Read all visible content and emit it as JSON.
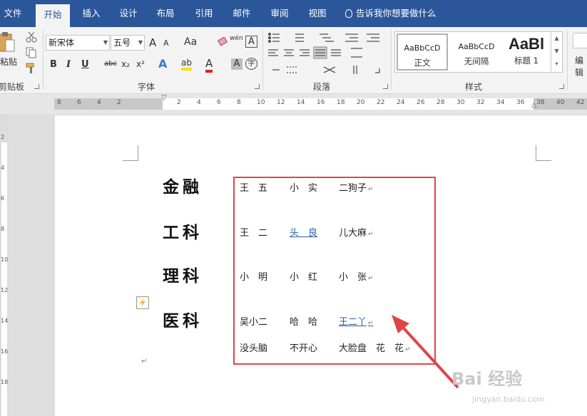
{
  "menu": {
    "tabs": [
      "文件",
      "开始",
      "插入",
      "设计",
      "布局",
      "引用",
      "邮件",
      "审阅",
      "视图"
    ],
    "tell_me": "告诉我你想要做什么"
  },
  "ribbon": {
    "clipboard": {
      "paste": "粘贴",
      "group": "剪贴板"
    },
    "font": {
      "group": "字体",
      "font_name": "新宋体",
      "font_size": "五号",
      "bold": "B",
      "italic": "I",
      "underline": "U",
      "strike": "abc",
      "subscript": "x₂",
      "superscript": "x²",
      "grow": "A",
      "shrink": "A",
      "case": "Aa",
      "phonetic": "wén",
      "border_char": "A",
      "effects": "A",
      "highlight": "ab",
      "font_color": "A",
      "char_shade": "A",
      "enclose": "字"
    },
    "paragraph": {
      "group": "段落"
    },
    "styles": {
      "group": "样式",
      "items": [
        {
          "sample": "AaBbCcD",
          "name": "正文"
        },
        {
          "sample": "AaBbCcD",
          "name": "无间隔"
        },
        {
          "sample": "AaBl",
          "name": "标题 1"
        }
      ]
    },
    "editing": {
      "label": "编辑"
    }
  },
  "ruler": {
    "left_ticks": [
      "8",
      "6",
      "4",
      "2"
    ],
    "right_ticks": [
      "2",
      "4",
      "6",
      "8",
      "10",
      "12",
      "14",
      "16",
      "18",
      "20",
      "22",
      "24",
      "26",
      "28",
      "30",
      "32",
      "34",
      "36",
      "38",
      "40",
      "42",
      "44"
    ],
    "vertical_ticks": [
      "2",
      "4",
      "6",
      "8",
      "10",
      "12",
      "14",
      "16",
      "18"
    ]
  },
  "document": {
    "subjects": [
      "金融",
      "工科",
      "理科",
      "医科"
    ],
    "rows": [
      {
        "cells": [
          {
            "text": "王　五",
            "link": false
          },
          {
            "text": "小　实",
            "link": false
          },
          {
            "text": "二狗子",
            "link": false
          }
        ]
      },
      {
        "cells": [
          {
            "text": "王　二",
            "link": false
          },
          {
            "text": "头　良",
            "link": true
          },
          {
            "text": "儿大麻",
            "link": false
          }
        ]
      },
      {
        "cells": [
          {
            "text": "小　明",
            "link": false
          },
          {
            "text": "小　红",
            "link": false
          },
          {
            "text": "小　张",
            "link": false
          }
        ]
      },
      {
        "cells": [
          {
            "text": "吴小二",
            "link": false
          },
          {
            "text": "哈　哈",
            "link": false
          },
          {
            "text": "王二丫",
            "link": true
          }
        ]
      },
      {
        "cells": [
          {
            "text": "没头脑",
            "link": false
          },
          {
            "text": "不开心",
            "link": false
          },
          {
            "text": "大脸盘　花　花",
            "link": false
          }
        ]
      }
    ],
    "paragraph_mark": "↵"
  },
  "watermark": {
    "brand": "Bai  经验",
    "url": "jingyan.baidu.com"
  },
  "colors": {
    "ribbon_blue": "#2b579a",
    "annotation_red": "#e04444",
    "link_blue": "#2b5fa8"
  }
}
